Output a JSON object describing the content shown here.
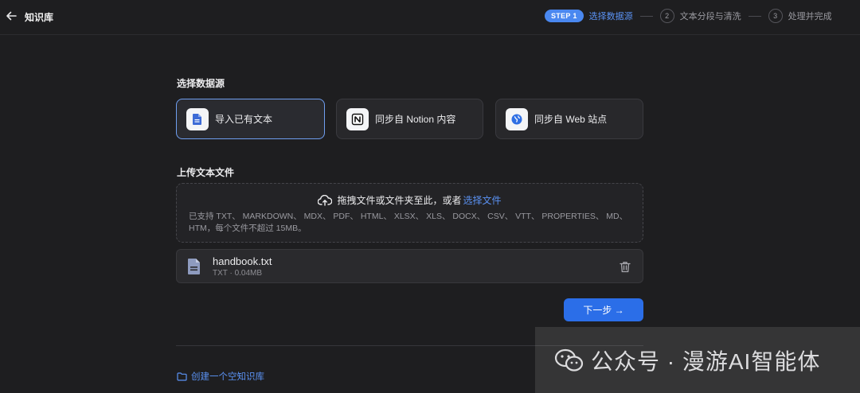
{
  "header": {
    "title": "知识库",
    "steps": [
      {
        "badge": "STEP 1",
        "label": "选择数据源",
        "active": true
      },
      {
        "number": "2",
        "label": "文本分段与清洗",
        "active": false
      },
      {
        "number": "3",
        "label": "处理并完成",
        "active": false
      }
    ]
  },
  "datasource": {
    "title": "选择数据源",
    "options": [
      {
        "label": "导入已有文本",
        "icon": "document-icon",
        "selected": true
      },
      {
        "label": "同步自 Notion 内容",
        "icon": "notion-icon",
        "selected": false
      },
      {
        "label": "同步自 Web 站点",
        "icon": "globe-icon",
        "selected": false
      }
    ]
  },
  "upload": {
    "title": "上传文本文件",
    "drop_text": "拖拽文件或文件夹至此，或者",
    "drop_link": "选择文件",
    "hint": "已支持 TXT、 MARKDOWN、 MDX、 PDF、 HTML、 XLSX、 XLS、 DOCX、 CSV、 VTT、 PROPERTIES、 MD、 HTM，每个文件不超过 15MB。"
  },
  "file": {
    "name": "handbook.txt",
    "meta": "TXT · 0.04MB"
  },
  "next_button": "下一步 →",
  "create_empty": "创建一个空知识库",
  "watermark": "公众号 · 漫游AI智能体",
  "colors": {
    "accent": "#2b6ee8",
    "link": "#5b93f5",
    "background": "#1e1e20"
  }
}
